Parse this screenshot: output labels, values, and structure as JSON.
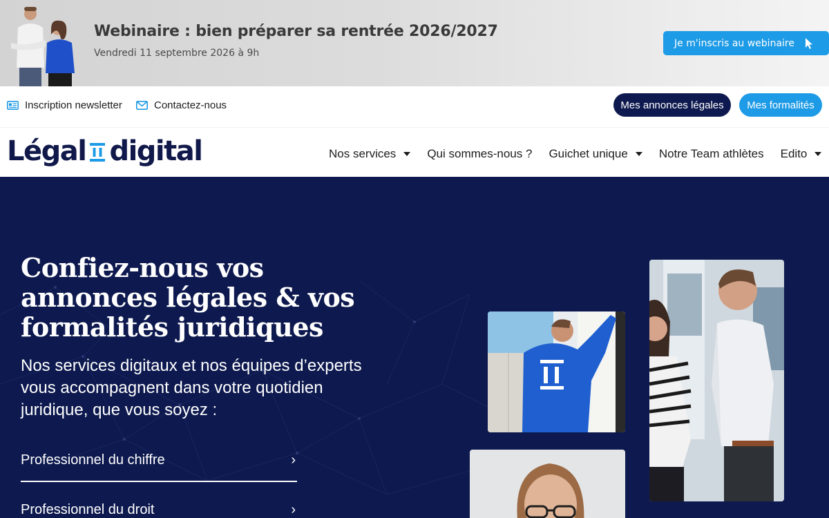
{
  "banner": {
    "title": "Webinaire : bien préparer sa rentrée 2026/2027",
    "date": "Vendredi 11 septembre 2026 à 9h",
    "cta_label": "Je m'inscris au webinaire",
    "cta_color": "#1e9be6"
  },
  "utility": {
    "newsletter_label": "Inscription newsletter",
    "contact_label": "Contactez-nous",
    "annonces_label": "Mes annonces légales",
    "formalites_label": "Mes formalités",
    "annonces_color": "#0e1a4f",
    "formalites_color": "#1e9be6"
  },
  "logo": {
    "left_text": "Légal",
    "right_text": "digital"
  },
  "nav": {
    "items": [
      {
        "label": "Nos services",
        "dropdown": true
      },
      {
        "label": "Qui sommes-nous ?",
        "dropdown": false
      },
      {
        "label": "Guichet unique",
        "dropdown": true
      },
      {
        "label": "Notre Team athlètes",
        "dropdown": false
      },
      {
        "label": "Edito",
        "dropdown": true
      }
    ]
  },
  "hero": {
    "title": "Confiez-nous vos annonces légales & vos formalités juridiques",
    "subtitle": "Nos services digitaux et nos équipes d’experts vous accompagnent dans votre quotidien juridique, que vous soyez :",
    "links": [
      {
        "label": "Professionnel du chiffre",
        "chevron": "›"
      },
      {
        "label": "Professionnel du droit",
        "chevron": "›"
      }
    ],
    "background_color": "#0e1a4f"
  },
  "icons": {
    "newsletter": "newspaper-icon",
    "contact": "envelope-icon",
    "cta_cursor": "cursor-icon"
  }
}
